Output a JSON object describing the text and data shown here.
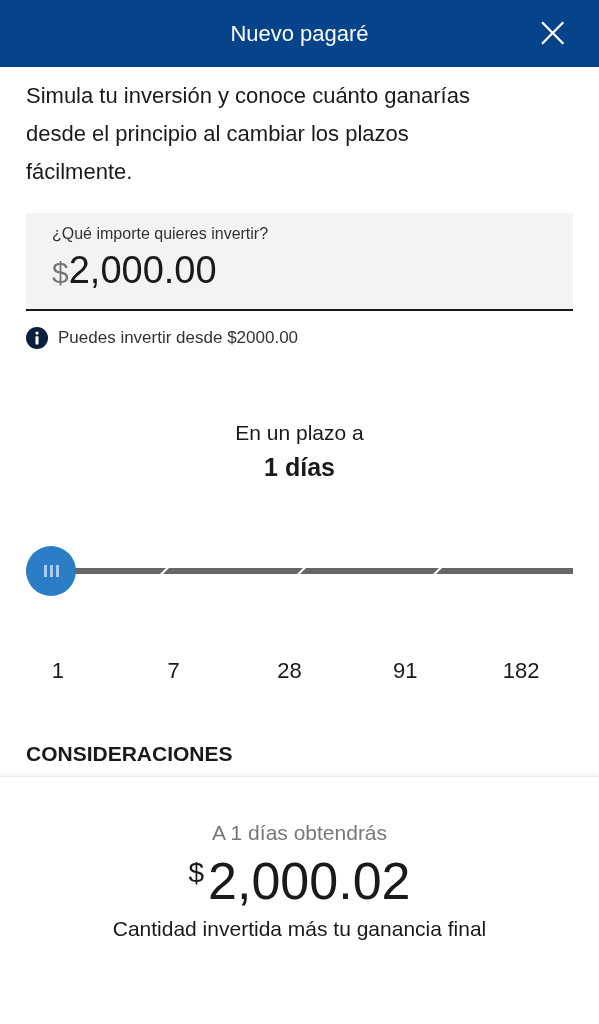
{
  "header": {
    "title": "Nuevo pagaré",
    "close": "×"
  },
  "intro": "Simula tu inversión y conoce cuánto ganarías desde el principio al cambiar los plazos fácilmente.",
  "amount_field": {
    "label": "¿Qué importe quieres invertir?",
    "currency": "$",
    "value": "2,000.00"
  },
  "info": "Puedes invertir desde $2000.00",
  "term": {
    "caption": "En un plazo a",
    "value": "1 días"
  },
  "slider": {
    "stops": [
      "1",
      "7",
      "28",
      "91",
      "182"
    ]
  },
  "considerations": "CONSIDERACIONES",
  "result": {
    "caption": "A 1 días obtendrás",
    "currency": "$",
    "amount": "2,000.02",
    "note": "Cantidad invertida más tu ganancia final"
  }
}
